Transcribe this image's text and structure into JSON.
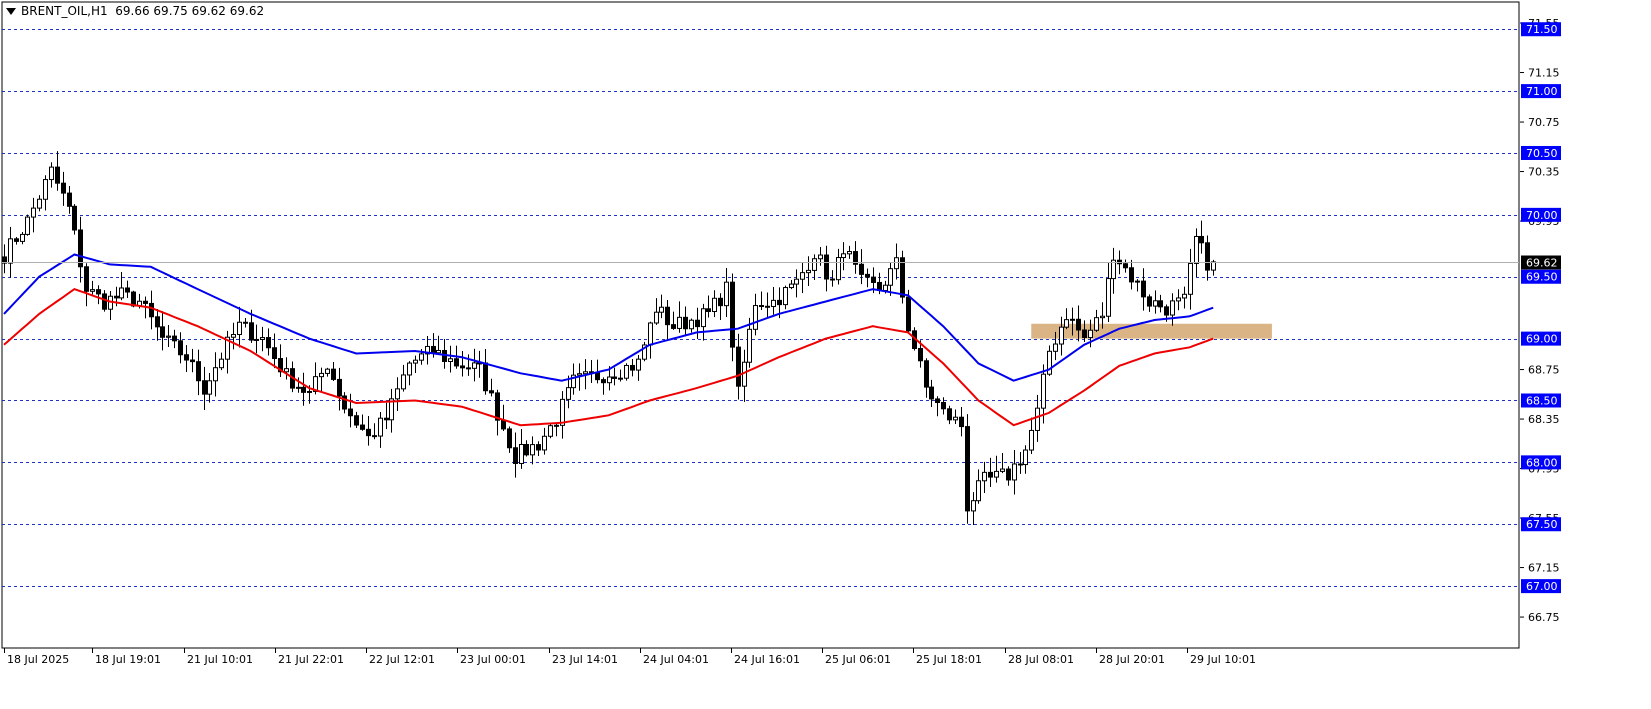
{
  "header": {
    "symbol": "BRENT_OIL,H1",
    "ohlc": "69.66 69.75 69.62 69.62"
  },
  "chart_data": {
    "type": "candlestick",
    "instrument": "BRENT_OIL",
    "timeframe": "H1",
    "ylim": [
      66.5,
      71.72
    ],
    "y_tick_labels": [
      "71.55",
      "71.15",
      "70.75",
      "70.35",
      "69.95",
      "68.75",
      "68.35",
      "67.95",
      "67.55",
      "67.15",
      "66.75"
    ],
    "price_levels": [
      "71.50",
      "71.00",
      "70.50",
      "70.00",
      "69.50",
      "69.00",
      "68.50",
      "68.00",
      "67.50",
      "67.00"
    ],
    "current_price": "69.62",
    "x_tick_labels": [
      "18 Jul 2025",
      "18 Jul 19:01",
      "21 Jul 10:01",
      "21 Jul 22:01",
      "22 Jul 12:01",
      "23 Jul 00:01",
      "23 Jul 14:01",
      "24 Jul 04:01",
      "24 Jul 16:01",
      "25 Jul 06:01",
      "25 Jul 18:01",
      "28 Jul 08:01",
      "28 Jul 20:01",
      "29 Jul 10:01"
    ],
    "zone": {
      "y_low": 69.0,
      "y_high": 69.12,
      "x_from_bar": 175,
      "x_to_bar": 216,
      "color": "#d9b07e"
    },
    "close_anchors": [
      [
        0,
        69.68
      ],
      [
        4,
        69.95
      ],
      [
        8,
        70.35
      ],
      [
        11,
        70.05
      ],
      [
        14,
        69.4
      ],
      [
        17,
        69.3
      ],
      [
        20,
        69.35
      ],
      [
        23,
        69.3
      ],
      [
        27,
        69.0
      ],
      [
        31,
        68.85
      ],
      [
        34,
        68.6
      ],
      [
        38,
        68.95
      ],
      [
        40,
        69.1
      ],
      [
        44,
        69.0
      ],
      [
        48,
        68.7
      ],
      [
        52,
        68.55
      ],
      [
        55,
        68.8
      ],
      [
        58,
        68.45
      ],
      [
        62,
        68.2
      ],
      [
        65,
        68.35
      ],
      [
        69,
        68.8
      ],
      [
        73,
        68.9
      ],
      [
        77,
        68.8
      ],
      [
        81,
        68.75
      ],
      [
        84,
        68.4
      ],
      [
        87,
        68.05
      ],
      [
        91,
        68.15
      ],
      [
        94,
        68.35
      ],
      [
        97,
        68.65
      ],
      [
        101,
        68.7
      ],
      [
        105,
        68.75
      ],
      [
        108,
        68.8
      ],
      [
        111,
        69.25
      ],
      [
        114,
        69.1
      ],
      [
        117,
        69.15
      ],
      [
        120,
        69.2
      ],
      [
        123,
        69.4
      ],
      [
        125,
        68.55
      ],
      [
        128,
        69.3
      ],
      [
        131,
        69.3
      ],
      [
        135,
        69.45
      ],
      [
        138,
        69.7
      ],
      [
        141,
        69.45
      ],
      [
        143,
        69.75
      ],
      [
        146,
        69.45
      ],
      [
        149,
        69.4
      ],
      [
        152,
        69.6
      ],
      [
        154,
        69.1
      ],
      [
        157,
        68.6
      ],
      [
        160,
        68.4
      ],
      [
        163,
        68.3
      ],
      [
        164,
        67.65
      ],
      [
        167,
        67.85
      ],
      [
        171,
        67.9
      ],
      [
        174,
        68.1
      ],
      [
        176,
        68.4
      ],
      [
        178,
        68.9
      ],
      [
        181,
        69.2
      ],
      [
        184,
        69.0
      ],
      [
        187,
        69.2
      ],
      [
        189,
        69.7
      ],
      [
        192,
        69.5
      ],
      [
        195,
        69.3
      ],
      [
        198,
        69.25
      ],
      [
        201,
        69.3
      ],
      [
        203,
        69.8
      ],
      [
        205,
        69.62
      ]
    ],
    "sma_blue_anchors": [
      [
        0,
        69.2
      ],
      [
        6,
        69.5
      ],
      [
        12,
        69.68
      ],
      [
        18,
        69.6
      ],
      [
        25,
        69.58
      ],
      [
        33,
        69.4
      ],
      [
        42,
        69.2
      ],
      [
        52,
        69.0
      ],
      [
        60,
        68.88
      ],
      [
        70,
        68.9
      ],
      [
        78,
        68.85
      ],
      [
        88,
        68.72
      ],
      [
        95,
        68.66
      ],
      [
        103,
        68.75
      ],
      [
        110,
        68.95
      ],
      [
        118,
        69.05
      ],
      [
        125,
        69.08
      ],
      [
        132,
        69.2
      ],
      [
        140,
        69.3
      ],
      [
        148,
        69.4
      ],
      [
        154,
        69.35
      ],
      [
        160,
        69.1
      ],
      [
        166,
        68.8
      ],
      [
        172,
        68.66
      ],
      [
        178,
        68.75
      ],
      [
        184,
        68.95
      ],
      [
        190,
        69.08
      ],
      [
        196,
        69.15
      ],
      [
        202,
        69.18
      ],
      [
        206,
        69.25
      ]
    ],
    "sma_red_anchors": [
      [
        0,
        68.95
      ],
      [
        6,
        69.2
      ],
      [
        12,
        69.4
      ],
      [
        18,
        69.3
      ],
      [
        25,
        69.25
      ],
      [
        33,
        69.1
      ],
      [
        42,
        68.9
      ],
      [
        52,
        68.6
      ],
      [
        60,
        68.48
      ],
      [
        70,
        68.5
      ],
      [
        78,
        68.45
      ],
      [
        88,
        68.3
      ],
      [
        95,
        68.32
      ],
      [
        103,
        68.38
      ],
      [
        110,
        68.5
      ],
      [
        118,
        68.6
      ],
      [
        125,
        68.7
      ],
      [
        132,
        68.85
      ],
      [
        140,
        69.0
      ],
      [
        148,
        69.1
      ],
      [
        154,
        69.05
      ],
      [
        160,
        68.8
      ],
      [
        166,
        68.5
      ],
      [
        172,
        68.3
      ],
      [
        178,
        68.4
      ],
      [
        184,
        68.58
      ],
      [
        190,
        68.78
      ],
      [
        196,
        68.88
      ],
      [
        202,
        68.93
      ],
      [
        206,
        69.0
      ]
    ],
    "colors": {
      "background": "#ffffff",
      "grid": "#2233bb",
      "sma_fast": "#0000ee",
      "sma_slow": "#ee0000",
      "candle_bull": "#ffffff",
      "candle_bear": "#000000",
      "price_label_bg": "#000000",
      "level_label_bg": "#0000ff",
      "level_label_text": "#ffffff"
    }
  }
}
